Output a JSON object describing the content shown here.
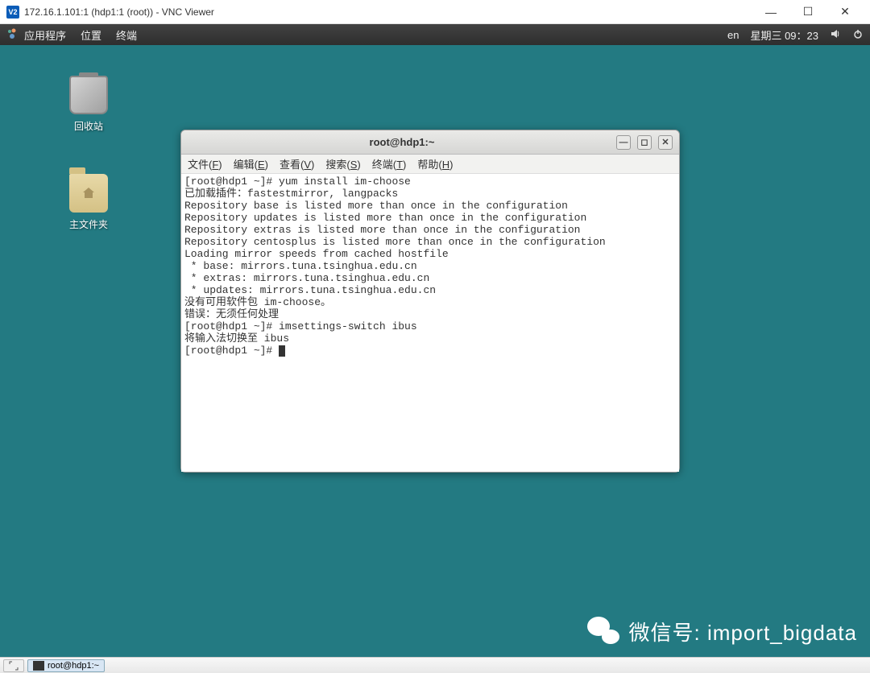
{
  "vnc": {
    "icon_text": "V2",
    "title": "172.16.1.101:1 (hdp1:1 (root)) - VNC Viewer",
    "min_icon": "—",
    "max_icon": "☐",
    "close_icon": "✕"
  },
  "panel": {
    "apps": "应用程序",
    "places": "位置",
    "terminal": "终端",
    "lang": "en",
    "date": "星期三 09：23"
  },
  "desktop_icons": {
    "trash": "回收站",
    "home": "主文件夹"
  },
  "terminal": {
    "title": "root@hdp1:~",
    "menu": {
      "file": "文件(",
      "file_u": "F",
      "edit": "编辑(",
      "edit_u": "E",
      "view": "查看(",
      "view_u": "V",
      "search": "搜索(",
      "search_u": "S",
      "term": "终端(",
      "term_u": "T",
      "help": "帮助(",
      "help_u": "H",
      "close": ")"
    },
    "lines": [
      "[root@hdp1 ~]# yum install im-choose",
      "已加载插件：fastestmirror, langpacks",
      "Repository base is listed more than once in the configuration",
      "Repository updates is listed more than once in the configuration",
      "Repository extras is listed more than once in the configuration",
      "Repository centosplus is listed more than once in the configuration",
      "Loading mirror speeds from cached hostfile",
      " * base: mirrors.tuna.tsinghua.edu.cn",
      " * extras: mirrors.tuna.tsinghua.edu.cn",
      " * updates: mirrors.tuna.tsinghua.edu.cn",
      "没有可用软件包 im-choose。",
      "错误：无须任何处理",
      "[root@hdp1 ~]# imsettings-switch ibus",
      "将输入法切换至 ibus",
      "[root@hdp1 ~]# "
    ]
  },
  "watermark": {
    "text": "微信号: import_bigdata"
  },
  "taskbar": {
    "task": "root@hdp1:~"
  }
}
